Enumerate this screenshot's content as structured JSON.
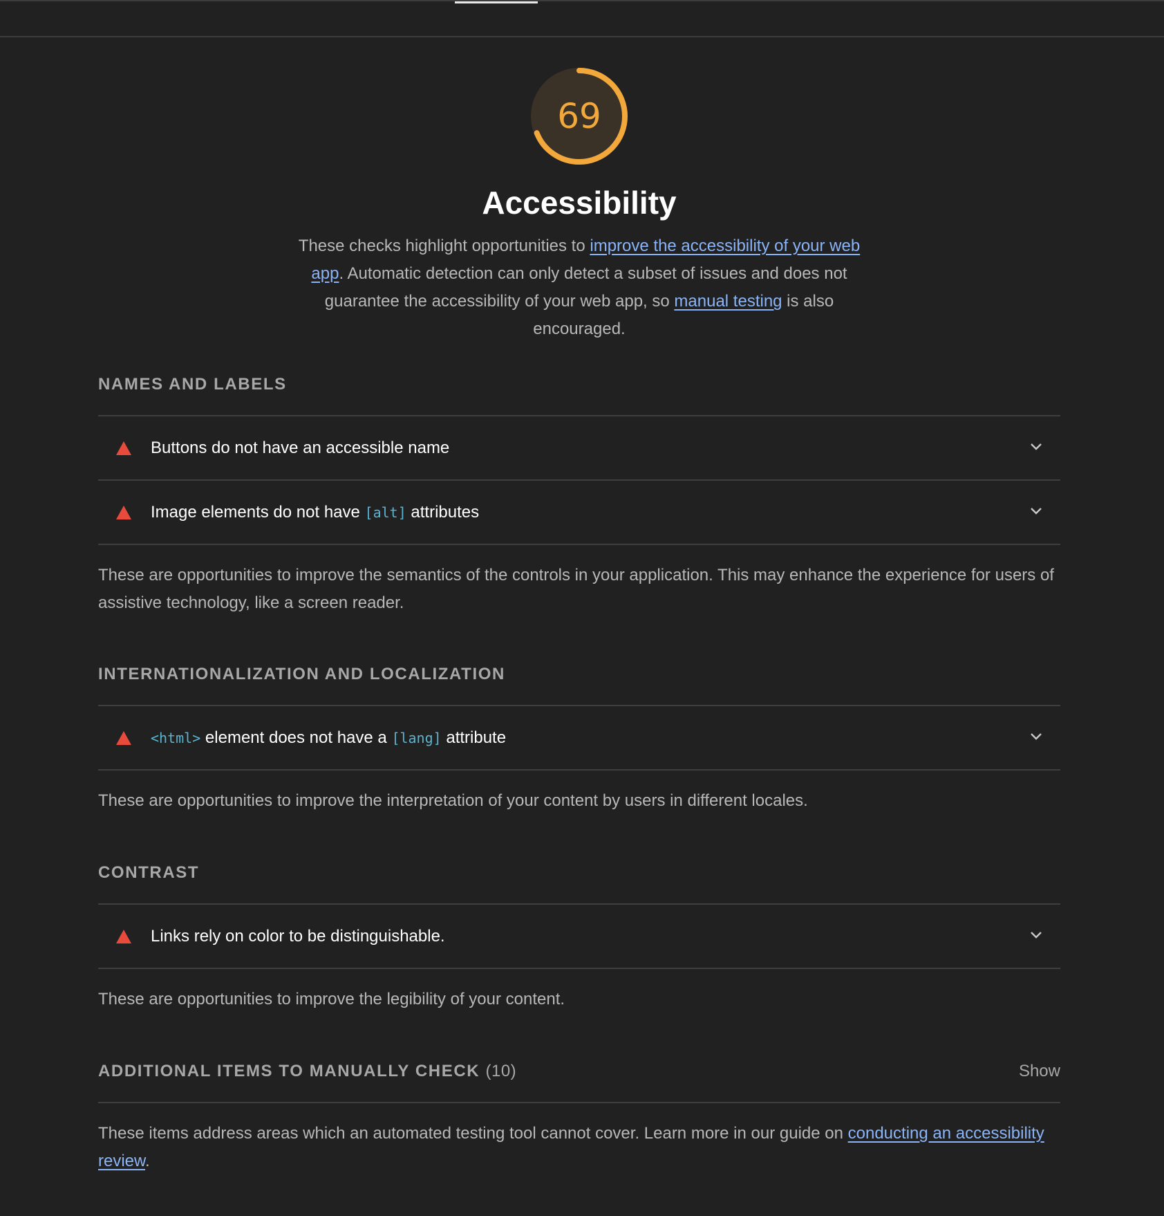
{
  "score": {
    "value": "69",
    "fraction": 0.69,
    "color": "#f3a83b"
  },
  "category": {
    "title": "Accessibility",
    "desc_part1": "These checks highlight opportunities to ",
    "desc_link1": "improve the accessibility of your web app",
    "desc_part2": ". Automatic detection can only detect a subset of issues and does not guarantee the accessibility of your web app, so ",
    "desc_link2": "manual testing",
    "desc_part3": " is also encouraged."
  },
  "groups": [
    {
      "title": "NAMES AND LABELS",
      "audits": [
        {
          "title": "Buttons do not have an accessible name"
        },
        {
          "title_part1": "Image elements do not have ",
          "code": "[alt]",
          "title_part2": " attributes"
        }
      ],
      "description": "These are opportunities to improve the semantics of the controls in your application. This may enhance the experience for users of assistive technology, like a screen reader."
    },
    {
      "title": "INTERNATIONALIZATION AND LOCALIZATION",
      "audits": [
        {
          "code1": "<html>",
          "title_part1": " element does not have a ",
          "code2": "[lang]",
          "title_part2": " attribute"
        }
      ],
      "description": "These are opportunities to improve the interpretation of your content by users in different locales."
    },
    {
      "title": "CONTRAST",
      "audits": [
        {
          "title": "Links rely on color to be distinguishable."
        }
      ],
      "description": "These are opportunities to improve the legibility of your content."
    }
  ],
  "manual": {
    "title": "ADDITIONAL ITEMS TO MANUALLY CHECK",
    "count": "(10)",
    "show_label": "Show",
    "desc_part1": "These items address areas which an automated testing tool cannot cover. Learn more in our guide on ",
    "desc_link": "conducting an accessibility review",
    "desc_part2": "."
  },
  "colors": {
    "background": "#212121",
    "fail": "#e84b3c",
    "link": "#8ab4f8",
    "code": "#5ab4d0"
  },
  "icons": {
    "fail": "fail-triangle-icon",
    "expand": "chevron-down-icon"
  }
}
